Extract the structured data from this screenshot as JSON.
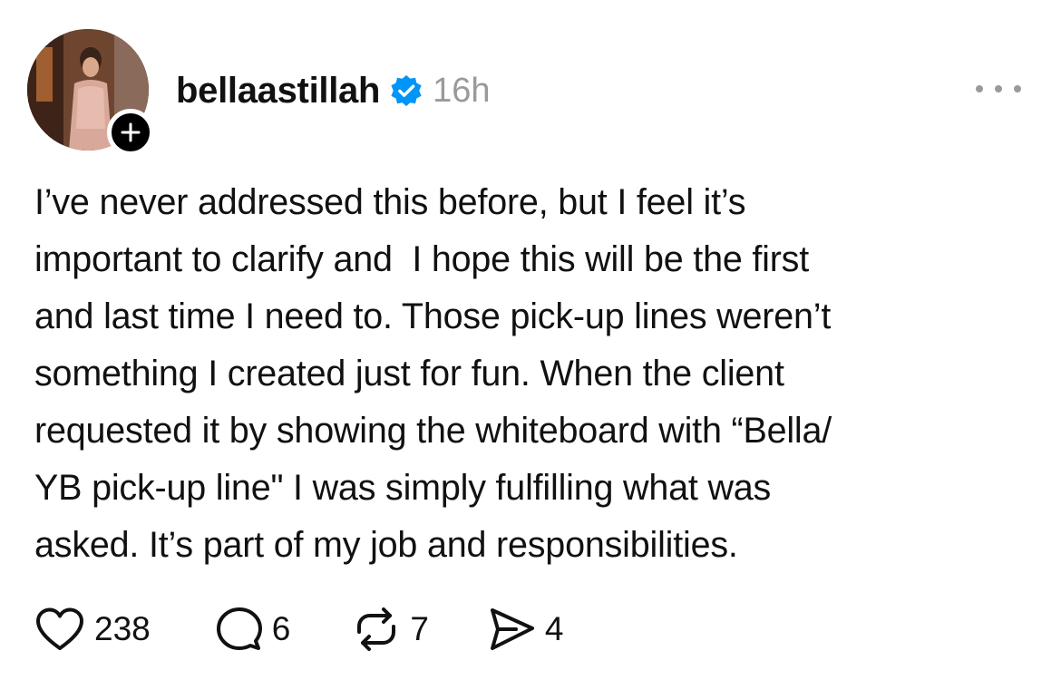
{
  "post": {
    "username": "bellaastillah",
    "verified": true,
    "timestamp": "16h",
    "body": "I’ve never addressed this before, but I feel it’s\nimportant to clarify and  I hope this will be the first\nand last time I need to. Those pick-up lines weren’t\nsomething I created just for fun. When the client\nrequested it by showing the whiteboard with “Bella/\nYB pick-up line\" I was simply fulfilling what was\nasked. It’s part of my job and responsibilities.",
    "actions": {
      "likes": "238",
      "replies": "6",
      "reposts": "7",
      "shares": "4"
    }
  },
  "icons": {
    "follow": "plus-icon",
    "verified": "verified-badge-icon",
    "more": "more-horizontal-icon",
    "like": "heart-icon",
    "reply": "comment-bubble-icon",
    "repost": "repost-icon",
    "share": "send-icon"
  },
  "colors": {
    "verified_blue": "#0095f6",
    "timestamp_gray": "#9a9a9a",
    "text": "#111111"
  }
}
